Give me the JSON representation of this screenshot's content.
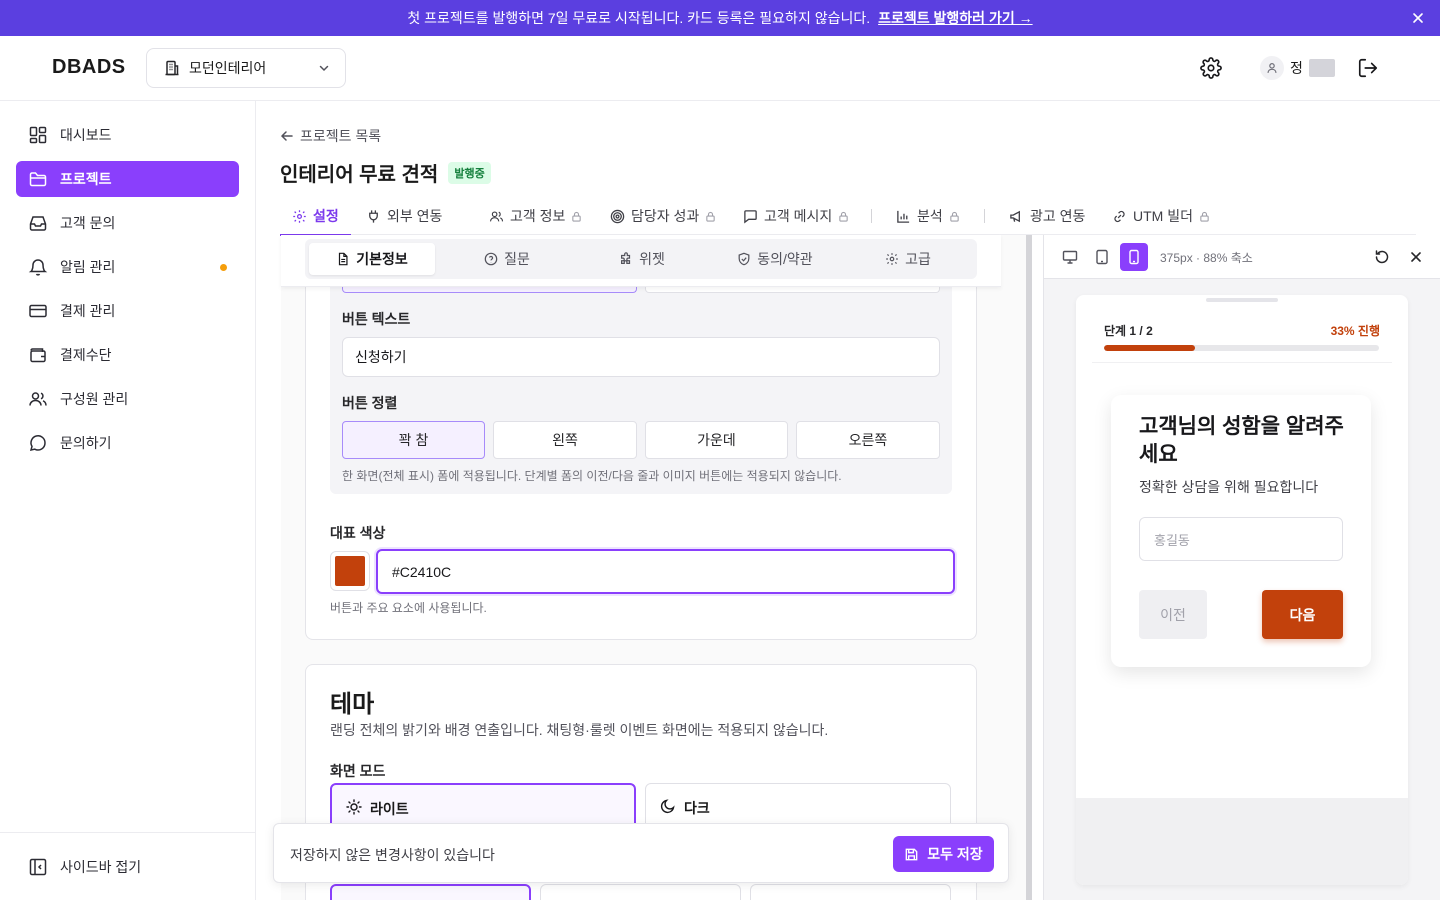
{
  "banner": {
    "message": "첫 프로젝트를 발행하면 7일 무료로 시작됩니다. 카드 등록은 필요하지 않습니다.",
    "link": "프로젝트 발행하러 가기 →"
  },
  "header": {
    "logo": "DBADS",
    "workspace": "모던인테리어",
    "user_name": "정"
  },
  "sidebar": {
    "items": [
      {
        "label": "대시보드",
        "icon": "dashboard-icon"
      },
      {
        "label": "프로젝트",
        "icon": "folder-icon",
        "active": true
      },
      {
        "label": "고객 문의",
        "icon": "inbox-icon"
      },
      {
        "label": "알림 관리",
        "icon": "bell-icon",
        "dot": true
      },
      {
        "label": "결제 관리",
        "icon": "card-icon"
      },
      {
        "label": "결제수단",
        "icon": "wallet-icon"
      },
      {
        "label": "구성원 관리",
        "icon": "users-icon"
      },
      {
        "label": "문의하기",
        "icon": "chat-icon"
      }
    ],
    "collapse": "사이드바 접기"
  },
  "page": {
    "back": "프로젝트 목록",
    "title": "인테리어 무료 견적",
    "status": "발행중"
  },
  "tabs": [
    {
      "label": "설정",
      "active": true
    },
    {
      "label": "외부 연동"
    },
    {
      "label": "고객 정보",
      "locked": true
    },
    {
      "label": "담당자 성과",
      "locked": true
    },
    {
      "label": "고객 메시지",
      "locked": true
    },
    {
      "label": "분석",
      "locked": true
    },
    {
      "label": "광고 연동"
    },
    {
      "label": "UTM 빌더",
      "locked": true
    }
  ],
  "subtabs": [
    {
      "label": "기본정보",
      "active": true
    },
    {
      "label": "질문"
    },
    {
      "label": "위젯"
    },
    {
      "label": "동의/약관"
    },
    {
      "label": "고급"
    }
  ],
  "editor": {
    "button_text_label": "버튼 텍스트",
    "button_text_value": "신청하기",
    "button_align_label": "버튼 정렬",
    "align_options": [
      "꽉 참",
      "왼쪽",
      "가운데",
      "오른쪽"
    ],
    "align_selected": "꽉 참",
    "align_hint": "한 화면(전체 표시) 폼에 적용됩니다. 단계별 폼의 이전/다음 줄과 이미지 버튼에는 적용되지 않습니다.",
    "color_label": "대표 색상",
    "color_value": "#C2410C",
    "color_hint": "버튼과 주요 요소에 사용됩니다.",
    "theme_title": "테마",
    "theme_desc": "랜딩 전체의 밝기와 배경 연출입니다. 채팅형·룰렛 이벤트 화면에는 적용되지 않습니다.",
    "mode_label": "화면 모드",
    "mode_light": "라이트",
    "mode_dark": "다크"
  },
  "save_bar": {
    "message": "저장하지 않은 변경사항이 있습니다",
    "button": "모두 저장"
  },
  "preview": {
    "size_label": "375px · 88% 축소",
    "step": "단계 1 / 2",
    "progress_text": "33% 진행",
    "progress": 0.33,
    "question": "고객님의 성함을 알려주세요",
    "subtitle": "정확한 상담을 위해 필요합니다",
    "input_placeholder": "홍길동",
    "prev": "이전",
    "next": "다음"
  },
  "colors": {
    "brand": "#8a3ffc",
    "banner": "#5b3fe0",
    "accent": "#C2410C"
  }
}
